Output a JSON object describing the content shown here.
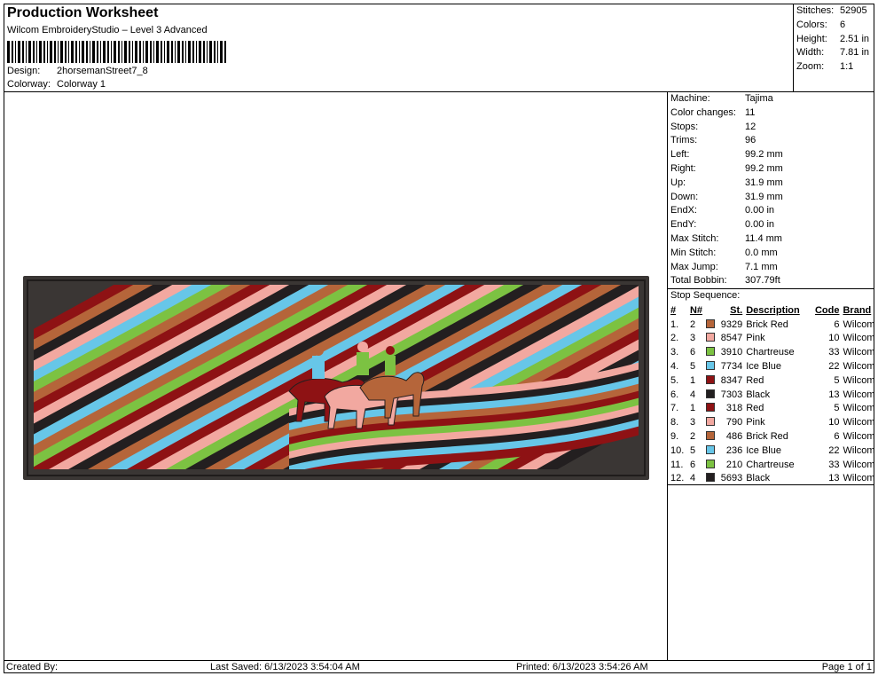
{
  "header": {
    "title": "Production Worksheet",
    "subtitle": "Wilcom EmbroideryStudio – Level 3 Advanced",
    "design_label": "Design:",
    "design_value": "2horsemanStreet7_8",
    "colorway_label": "Colorway:",
    "colorway_value": "Colorway 1"
  },
  "summary": [
    {
      "label": "Stitches:",
      "value": "52905"
    },
    {
      "label": "Colors:",
      "value": "6"
    },
    {
      "label": "Height:",
      "value": "2.51 in"
    },
    {
      "label": "Width:",
      "value": "7.81 in"
    },
    {
      "label": "Zoom:",
      "value": "1:1"
    }
  ],
  "machine": [
    {
      "label": "Machine:",
      "value": "Tajima"
    },
    {
      "label": "Color changes:",
      "value": "11"
    },
    {
      "label": "Stops:",
      "value": "12"
    },
    {
      "label": "Trims:",
      "value": "96"
    },
    {
      "label": "Left:",
      "value": "99.2 mm"
    },
    {
      "label": "Right:",
      "value": "99.2 mm"
    },
    {
      "label": "Up:",
      "value": "31.9 mm"
    },
    {
      "label": "Down:",
      "value": "31.9 mm"
    },
    {
      "label": "EndX:",
      "value": "0.00 in"
    },
    {
      "label": "EndY:",
      "value": "0.00 in"
    },
    {
      "label": "Max Stitch:",
      "value": "11.4 mm"
    },
    {
      "label": "Min Stitch:",
      "value": "0.0 mm"
    },
    {
      "label": "Max Jump:",
      "value": "7.1 mm"
    },
    {
      "label": "Total Bobbin:",
      "value": "307.79ft"
    }
  ],
  "stop_sequence": {
    "title": "Stop Sequence:",
    "headers": {
      "idx": "#",
      "n": "N#",
      "st": "St.",
      "desc": "Description",
      "code": "Code",
      "brand": "Brand"
    },
    "rows": [
      {
        "idx": "1.",
        "n": "2",
        "color": "#b5653a",
        "st": "9329",
        "desc": "Brick Red",
        "code": "6",
        "brand": "Wilcom"
      },
      {
        "idx": "2.",
        "n": "3",
        "color": "#f2a8a0",
        "st": "8547",
        "desc": "Pink",
        "code": "10",
        "brand": "Wilcom"
      },
      {
        "idx": "3.",
        "n": "6",
        "color": "#7cc242",
        "st": "3910",
        "desc": "Chartreuse",
        "code": "33",
        "brand": "Wilcom"
      },
      {
        "idx": "4.",
        "n": "5",
        "color": "#67c6e8",
        "st": "7734",
        "desc": "Ice Blue",
        "code": "22",
        "brand": "Wilcom"
      },
      {
        "idx": "5.",
        "n": "1",
        "color": "#8e1214",
        "st": "8347",
        "desc": "Red",
        "code": "5",
        "brand": "Wilcom"
      },
      {
        "idx": "6.",
        "n": "4",
        "color": "#231f20",
        "st": "7303",
        "desc": "Black",
        "code": "13",
        "brand": "Wilcom"
      },
      {
        "idx": "7.",
        "n": "1",
        "color": "#8e1214",
        "st": "318",
        "desc": "Red",
        "code": "5",
        "brand": "Wilcom"
      },
      {
        "idx": "8.",
        "n": "3",
        "color": "#f2a8a0",
        "st": "790",
        "desc": "Pink",
        "code": "10",
        "brand": "Wilcom"
      },
      {
        "idx": "9.",
        "n": "2",
        "color": "#b5653a",
        "st": "486",
        "desc": "Brick Red",
        "code": "6",
        "brand": "Wilcom"
      },
      {
        "idx": "10.",
        "n": "5",
        "color": "#67c6e8",
        "st": "236",
        "desc": "Ice Blue",
        "code": "22",
        "brand": "Wilcom"
      },
      {
        "idx": "11.",
        "n": "6",
        "color": "#7cc242",
        "st": "210",
        "desc": "Chartreuse",
        "code": "33",
        "brand": "Wilcom"
      },
      {
        "idx": "12.",
        "n": "4",
        "color": "#231f20",
        "st": "5693",
        "desc": "Black",
        "code": "13",
        "brand": "Wilcom"
      }
    ]
  },
  "footer": {
    "created_by": "Created By:",
    "last_saved": "Last Saved: 6/13/2023 3:54:04 AM",
    "printed": "Printed: 6/13/2023 3:54:26 AM",
    "page": "Page 1 of 1"
  },
  "design_colors": [
    "#b5653a",
    "#f2a8a0",
    "#7cc242",
    "#67c6e8",
    "#8e1214",
    "#231f20"
  ]
}
